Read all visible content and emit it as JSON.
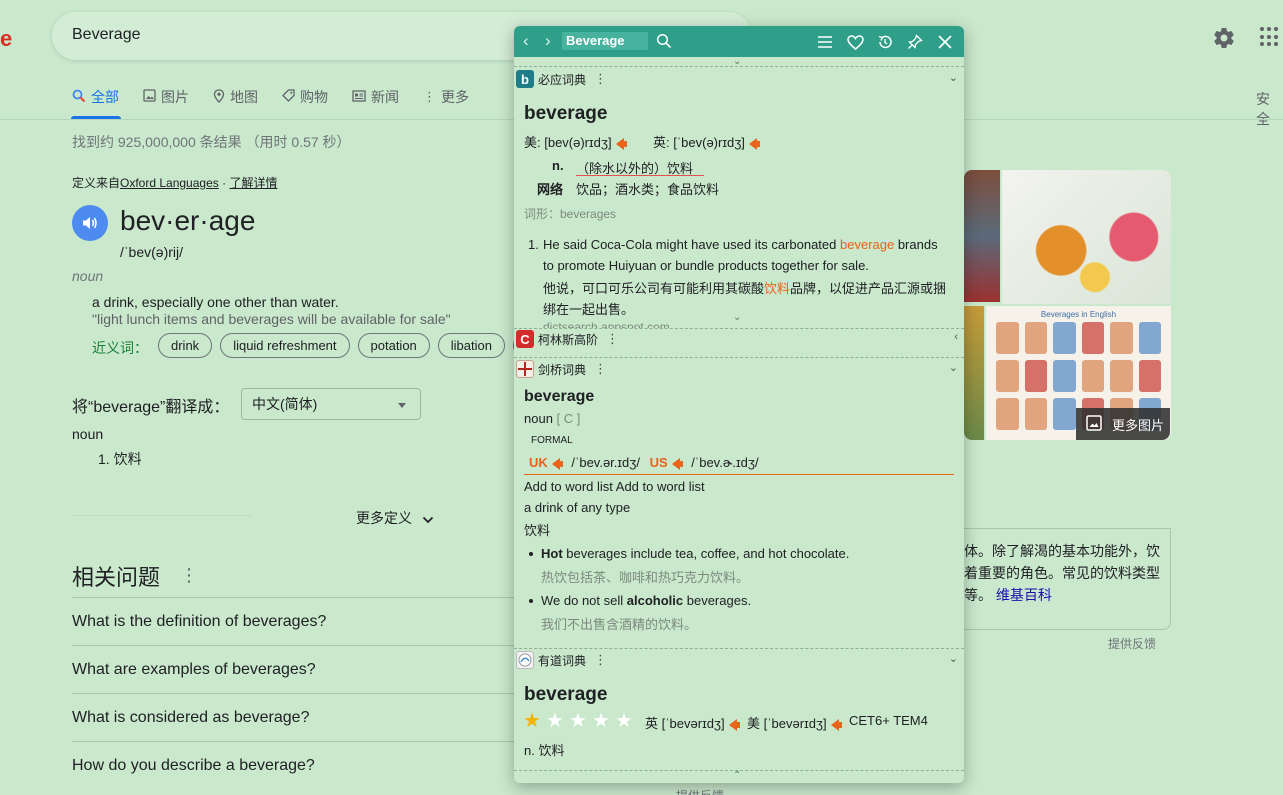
{
  "search": {
    "query": "Beverage"
  },
  "tabs": [
    {
      "label": "全部",
      "icon": "search-icon"
    },
    {
      "label": "图片",
      "icon": "image-icon"
    },
    {
      "label": "地图",
      "icon": "map-pin-icon"
    },
    {
      "label": "购物",
      "icon": "tag-icon"
    },
    {
      "label": "新闻",
      "icon": "news-icon"
    },
    {
      "label": "更多",
      "icon": "more-vert-icon"
    }
  ],
  "tabs_right": "安全",
  "results": {
    "stats": "找到约 925,000,000 条结果  （用时 0.57 秒）",
    "source_prefix": "定义来自",
    "source_name": "Oxford Languages",
    "source_sep": " · ",
    "source_more": "了解详情"
  },
  "definition": {
    "word": "bev·er·age",
    "phonetic": "/ˈbev(ə)rij/",
    "pos": "noun",
    "def": "a drink, especially one other than water.",
    "example": "\"light lunch items and beverages will be available for sale\"",
    "syn_label": "近义词：",
    "synonyms": [
      "drink",
      "liquid refreshment",
      "potation",
      "libation",
      "p"
    ]
  },
  "translate": {
    "label": "将“beverage”翻译成：",
    "lang": "中文(简体)",
    "pos": "noun",
    "item": "1. 饮料"
  },
  "more_definitions": "更多定义",
  "related": {
    "title": "相关问题",
    "questions": [
      "What is the definition of beverages?",
      "What are examples of beverages?",
      "What is considered as beverage?",
      "How do you describe a beverage?"
    ]
  },
  "knowledge_panel": {
    "image_title": "Beverages in English",
    "more_images": "更多图片",
    "text_line1": "体。除了解渴的基本功能外，饮",
    "text_line2": "着重要的角色。常见的饮料类型",
    "text_line3": "等。",
    "wiki_link": "维基百科",
    "feedback": "提供反馈"
  },
  "footer_feedback": "提供反馈",
  "popup": {
    "query": "Beverage",
    "bing": {
      "name": "必应词典",
      "word": "beverage",
      "us_label": "美: [bev(ə)rɪdʒ]",
      "uk_label": "英: [ˈbev(ə)rɪdʒ]",
      "n_label": "n.",
      "n_def": "（除水以外的）饮料",
      "web_label": "网络",
      "web_def": "饮品；酒水类；食品饮料",
      "forms": "词形：beverages",
      "ex_num": "1.",
      "ex_en_before": "He said Coca-Cola might have used its carbonated ",
      "ex_en_hl": "beverage",
      "ex_en_after": " brands",
      "ex_en_line2": "to promote Huiyuan or bundle products together for sale.",
      "ex_zh_before": "他说，可口可乐公司有可能利用其碳酸",
      "ex_zh_hl": "饮料",
      "ex_zh_after": "品牌，以促进产品汇源或捆",
      "ex_zh_line2": "绑在一起出售。",
      "ex_source": "dictsearch.appspot.com"
    },
    "collins": {
      "name": "柯林斯高阶"
    },
    "cambridge": {
      "name": "剑桥词典",
      "word": "beverage",
      "pos": "noun",
      "gram": "[ C ]",
      "register": "FORMAL",
      "uk": "UK",
      "uk_ipa": "/ˈbev.ər.ɪdʒ/",
      "us": "US",
      "us_ipa": "/ˈbev.ɚ.ɪdʒ/",
      "add_list": "Add to word list Add to word list",
      "def_en": "a drink of any type",
      "def_zh": "饮料",
      "ex1_bold": "Hot",
      "ex1_rest": " beverages include tea, coffee, and hot chocolate.",
      "ex1_zh": "热饮包括茶、咖啡和热巧克力饮料。",
      "ex2_pre": "We do not sell ",
      "ex2_bold": "alcoholic",
      "ex2_rest": " beverages.",
      "ex2_zh": "我们不出售含酒精的饮料。"
    },
    "youdao": {
      "name": "有道词典",
      "word": "beverage",
      "rating": 1,
      "rating_max": 5,
      "uk": "英 [ˈbevərɪdʒ]",
      "us": "美 [ˈbevərɪdʒ]",
      "tags": "CET6+ TEM4",
      "def": "n. 饮料"
    }
  },
  "colors": {
    "accent": "#1a73e8",
    "popup_bar": "#2f9f8a",
    "orange": "#e8641a",
    "background": "#c9e8cc"
  }
}
